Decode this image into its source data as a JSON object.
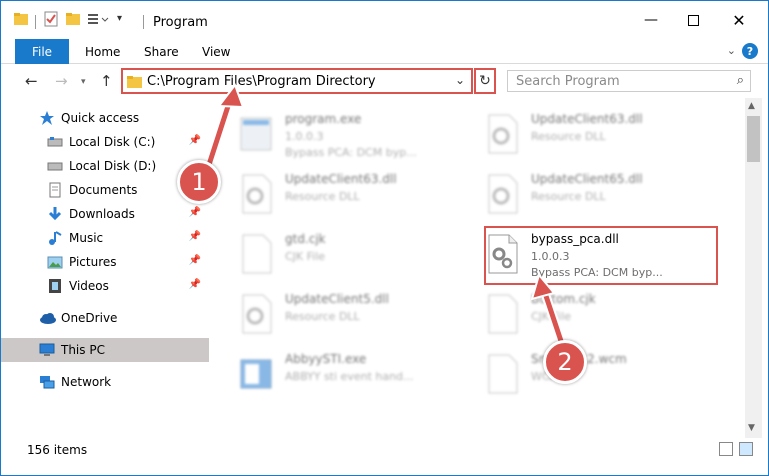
{
  "window": {
    "title": "Program",
    "controls": [
      "minimize",
      "maximize",
      "close"
    ]
  },
  "ribbon": {
    "tabs": [
      "File",
      "Home",
      "Share",
      "View"
    ]
  },
  "nav": {
    "address": "C:\\Program Files\\Program Directory",
    "search_placeholder": "Search Program"
  },
  "sidebar": {
    "items": [
      {
        "label": "Quick access",
        "icon": "star-icon",
        "pinned": false
      },
      {
        "label": "Local Disk (C:)",
        "icon": "drive-icon",
        "pinned": true
      },
      {
        "label": "Local Disk (D:)",
        "icon": "drive-icon",
        "pinned": false
      },
      {
        "label": "Documents",
        "icon": "documents-icon",
        "pinned": false
      },
      {
        "label": "Downloads",
        "icon": "download-icon",
        "pinned": true
      },
      {
        "label": "Music",
        "icon": "music-icon",
        "pinned": true
      },
      {
        "label": "Pictures",
        "icon": "pictures-icon",
        "pinned": true
      },
      {
        "label": "Videos",
        "icon": "videos-icon",
        "pinned": true
      },
      {
        "label": "OneDrive",
        "icon": "cloud-icon",
        "pinned": false
      },
      {
        "label": "This PC",
        "icon": "pc-icon",
        "pinned": false,
        "selected": true
      },
      {
        "label": "Network",
        "icon": "network-icon",
        "pinned": false
      }
    ]
  },
  "files": [
    {
      "name": "program.exe",
      "l2": "1.0.0.3",
      "l3": "Bypass PCA: DCM byp...",
      "blurred": true
    },
    {
      "name": "UpdateClient63.dll",
      "l2": "Resource DLL",
      "l3": "",
      "blurred": true
    },
    {
      "name": "UpdateClient63.dll",
      "l2": "Resource DLL",
      "l3": "",
      "blurred": true
    },
    {
      "name": "UpdateClient65.dll",
      "l2": "Resource DLL",
      "l3": "",
      "blurred": true
    },
    {
      "name": "gtd.cjk",
      "l2": "CJK File",
      "l3": "",
      "blurred": true
    },
    {
      "name": "bypass_pca.dll",
      "l2": "1.0.0.3",
      "l3": "Bypass PCA: DCM byp...",
      "blurred": false
    },
    {
      "name": "UpdateClient5.dll",
      "l2": "Resource DLL",
      "l3": "",
      "blurred": true
    },
    {
      "name": "Bottom.cjk",
      "l2": "CJK File",
      "l3": "",
      "blurred": true
    },
    {
      "name": "AbbyySTI.exe",
      "l2": "ABBYY sti event hand...",
      "l3": "",
      "blurred": true
    },
    {
      "name": "Snc...0712.wcm",
      "l2": "WCM",
      "l3": "",
      "blurred": true
    }
  ],
  "status": {
    "item_count": "156 items"
  },
  "annotations": {
    "step1": "1",
    "step2": "2",
    "color": "#d9534f"
  }
}
